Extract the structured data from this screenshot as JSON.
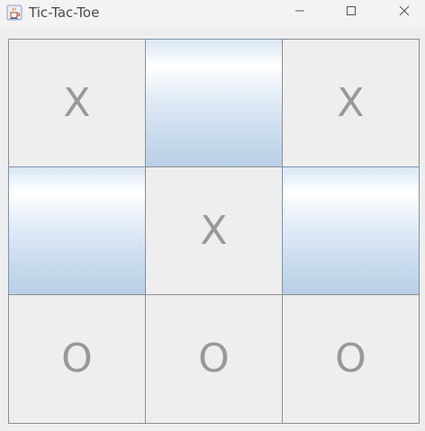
{
  "window": {
    "title": "Tic-Tac-Toe",
    "icon": "java-cup-icon",
    "controls": [
      "minimize-icon",
      "maximize-icon",
      "close-icon"
    ]
  },
  "board": {
    "cells": [
      {
        "value": "X"
      },
      {
        "value": ""
      },
      {
        "value": "X"
      },
      {
        "value": ""
      },
      {
        "value": "X"
      },
      {
        "value": ""
      },
      {
        "value": "O"
      },
      {
        "value": "O"
      },
      {
        "value": "O"
      }
    ]
  },
  "colors": {
    "mark": "#999999",
    "cell_background": "#eeeeee",
    "grid_line": "#8e8e8e",
    "empty_button_gradient_top": "#ffffff",
    "empty_button_gradient_bottom": "#b9cfe6"
  }
}
